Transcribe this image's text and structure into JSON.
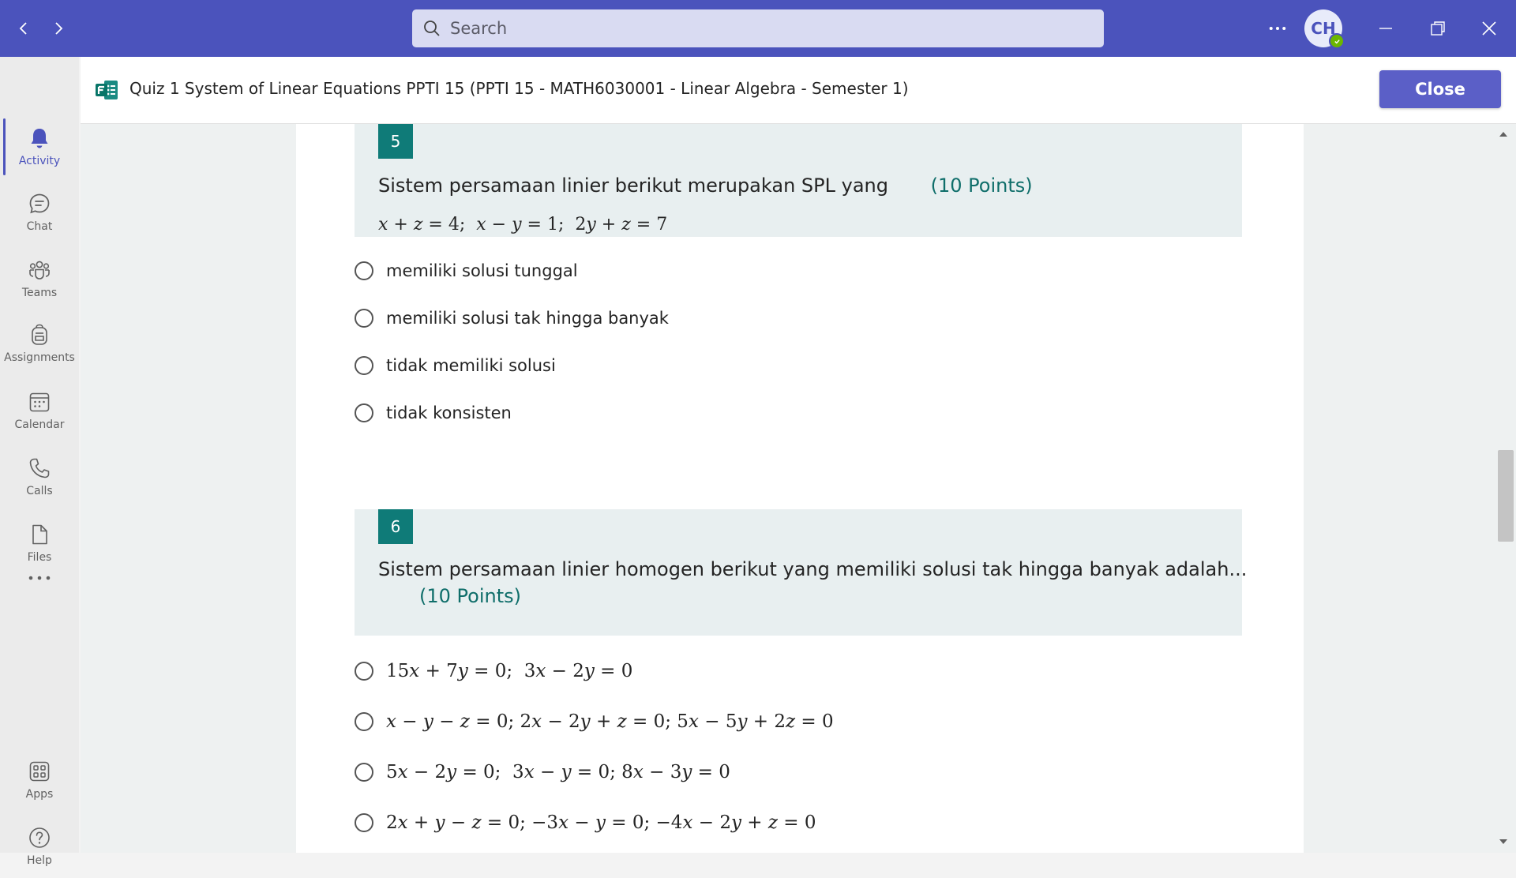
{
  "titlebar": {
    "search_placeholder": "Search",
    "avatar_initials": "CH",
    "bg_color": "#4b53bc"
  },
  "rail": {
    "items": [
      {
        "label": "Activity",
        "icon": "bell-icon"
      },
      {
        "label": "Chat",
        "icon": "chat-icon"
      },
      {
        "label": "Teams",
        "icon": "teams-icon"
      },
      {
        "label": "Assignments",
        "icon": "backpack-icon"
      },
      {
        "label": "Calendar",
        "icon": "calendar-icon"
      },
      {
        "label": "Calls",
        "icon": "phone-icon"
      },
      {
        "label": "Files",
        "icon": "file-icon"
      }
    ],
    "apps_label": "Apps",
    "help_label": "Help"
  },
  "header": {
    "title": "Quiz 1 System of Linear Equations PPTI 15 (PPTI 15 - MATH6030001 - Linear Algebra - Semester 1)",
    "close_label": "Close"
  },
  "questions": [
    {
      "number": "5",
      "title": "Sistem persamaan linier berikut merupakan SPL yang",
      "points": "(10 Points)",
      "options": [
        "memiliki solusi tunggal",
        "memiliki solusi tak hingga banyak",
        "tidak memiliki solusi",
        "tidak konsisten"
      ]
    },
    {
      "number": "6",
      "title": "Sistem persamaan linier homogen berikut yang memiliki solusi tak hingga banyak adalah...",
      "points": "(10 Points)"
    }
  ]
}
